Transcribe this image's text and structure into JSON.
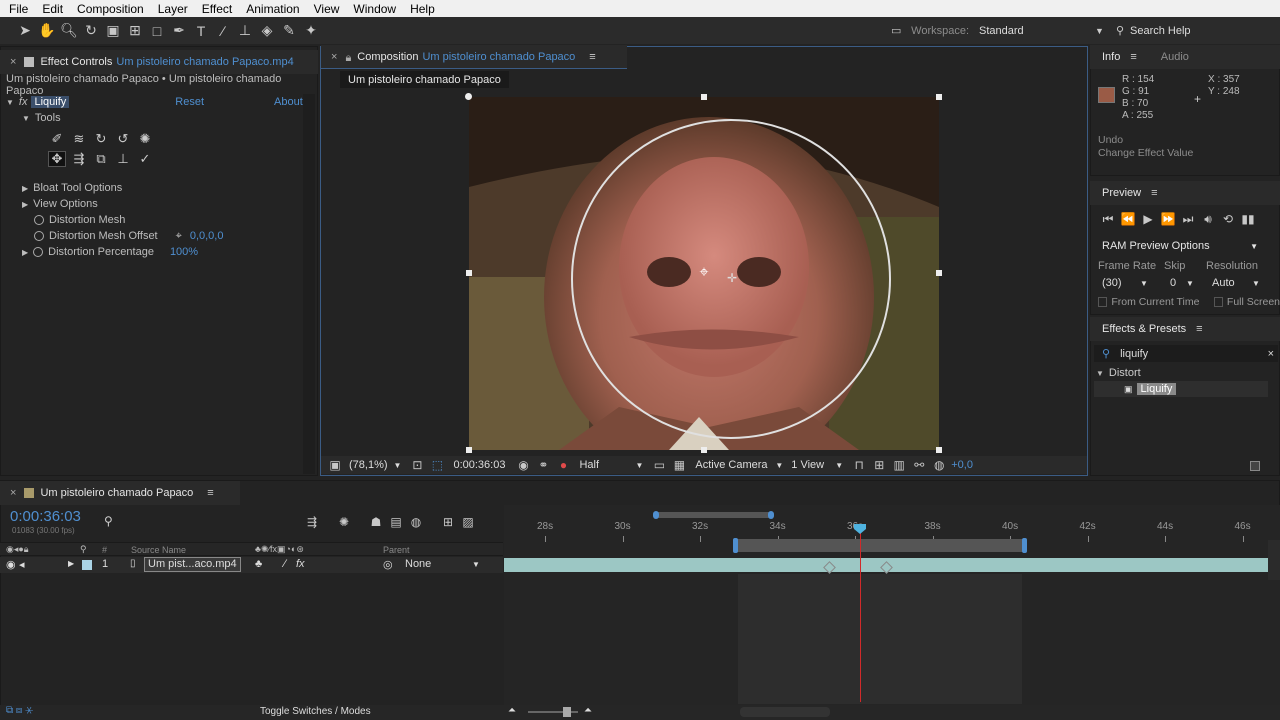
{
  "menu": [
    "File",
    "Edit",
    "Composition",
    "Layer",
    "Effect",
    "Animation",
    "View",
    "Window",
    "Help"
  ],
  "toolbar": {
    "workspace_label": "Workspace:",
    "workspace_value": "Standard",
    "search_help": "Search Help"
  },
  "effect_controls": {
    "tab_title": "Effect Controls",
    "tab_file": "Um pistoleiro chamado Papaco.mp4",
    "breadcrumb": "Um pistoleiro chamado Papaco • Um pistoleiro chamado Papaco",
    "effect_name": "Liquify",
    "reset": "Reset",
    "about": "About",
    "tools_label": "Tools",
    "bloat_tool_options": "Bloat Tool Options",
    "view_options": "View Options",
    "distortion_mesh": "Distortion Mesh",
    "distortion_mesh_offset": "Distortion Mesh Offset",
    "distortion_mesh_offset_value": "0,0,0,0",
    "distortion_percentage": "Distortion Percentage",
    "distortion_percentage_value": "100%"
  },
  "composition": {
    "tab_title": "Composition",
    "tab_name": "Um pistoleiro chamado Papaco",
    "sub_tab": "Um pistoleiro chamado Papaco",
    "zoom": "(78,1%)",
    "timecode": "0:00:36:03",
    "resolution": "Half",
    "camera": "Active Camera",
    "views": "1 View",
    "exposure": "+0,0"
  },
  "info": {
    "tab": "Info",
    "audio_tab": "Audio",
    "r": "R : 154",
    "g": "G : 91",
    "b": "B : 70",
    "a": "A : 255",
    "x": "X : 357",
    "y": "Y : 248",
    "swatch_color": "#9a5b46",
    "undo_label": "Undo",
    "undo_action": "Change Effect Value"
  },
  "preview": {
    "tab": "Preview",
    "ram_options": "RAM Preview Options",
    "frame_rate_label": "Frame Rate",
    "skip_label": "Skip",
    "resolution_label": "Resolution",
    "frame_rate_value": "(30)",
    "skip_value": "0",
    "resolution_value": "Auto",
    "from_current_time": "From Current Time",
    "full_screen": "Full Screen"
  },
  "effects_presets": {
    "tab": "Effects & Presets",
    "search_value": "liquify",
    "category": "Distort",
    "item": "Liquify"
  },
  "timeline": {
    "tab_name": "Um pistoleiro chamado Papaco",
    "timecode": "0:00:36:03",
    "fps": "01083 (30.00 fps)",
    "col_num": "#",
    "col_source": "Source Name",
    "col_parent": "Parent",
    "layer_index": "1",
    "layer_name": "Um pist...aco.mp4",
    "parent_value": "None",
    "ruler": [
      "28s",
      "30s",
      "32s",
      "34s",
      "36s",
      "38s",
      "40s",
      "42s",
      "44s",
      "46s"
    ],
    "toggle_label": "Toggle Switches / Modes"
  },
  "colors": {
    "accent_blue": "#4f8fd0",
    "playhead": "#d02a2a",
    "layer_bar": "#9cc7c4"
  }
}
